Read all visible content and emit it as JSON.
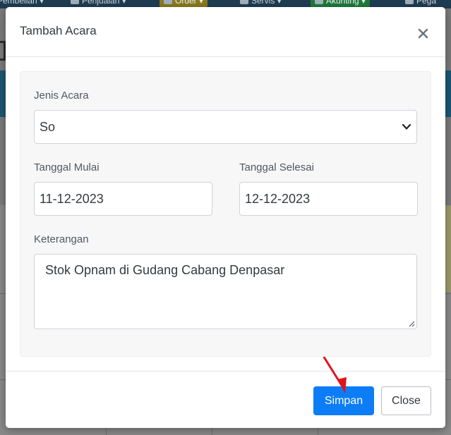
{
  "background": {
    "nav_items": [
      {
        "label": "Pembelian",
        "icon": "caret-down-icon"
      },
      {
        "label": "Penjualan",
        "icon": "cart-icon"
      },
      {
        "label": "Order",
        "icon": "box-icon"
      },
      {
        "label": "Servis",
        "icon": "gears-icon"
      },
      {
        "label": "Akunting",
        "icon": "money-icon"
      },
      {
        "label": "Pega",
        "icon": "monitor-icon"
      }
    ]
  },
  "modal": {
    "title": "Tambah Acara",
    "close_icon": "close-icon",
    "fields": {
      "jenis_acara": {
        "label": "Jenis Acara",
        "value": "So"
      },
      "tanggal_mulai": {
        "label": "Tanggal Mulai",
        "value": "11-12-2023"
      },
      "tanggal_selesai": {
        "label": "Tanggal Selesai",
        "value": "12-12-2023"
      },
      "keterangan": {
        "label": "Keterangan",
        "value": "Stok Opnam di Gudang Cabang Denpasar"
      }
    },
    "footer": {
      "save_label": "Simpan",
      "close_label": "Close"
    }
  },
  "annotation": {
    "arrow_color": "#e0141b"
  },
  "colors": {
    "primary": "#0d7df7",
    "modal_bg": "#ffffff",
    "body_box_bg": "#f7f7f8",
    "header_band": "#1c5777"
  }
}
